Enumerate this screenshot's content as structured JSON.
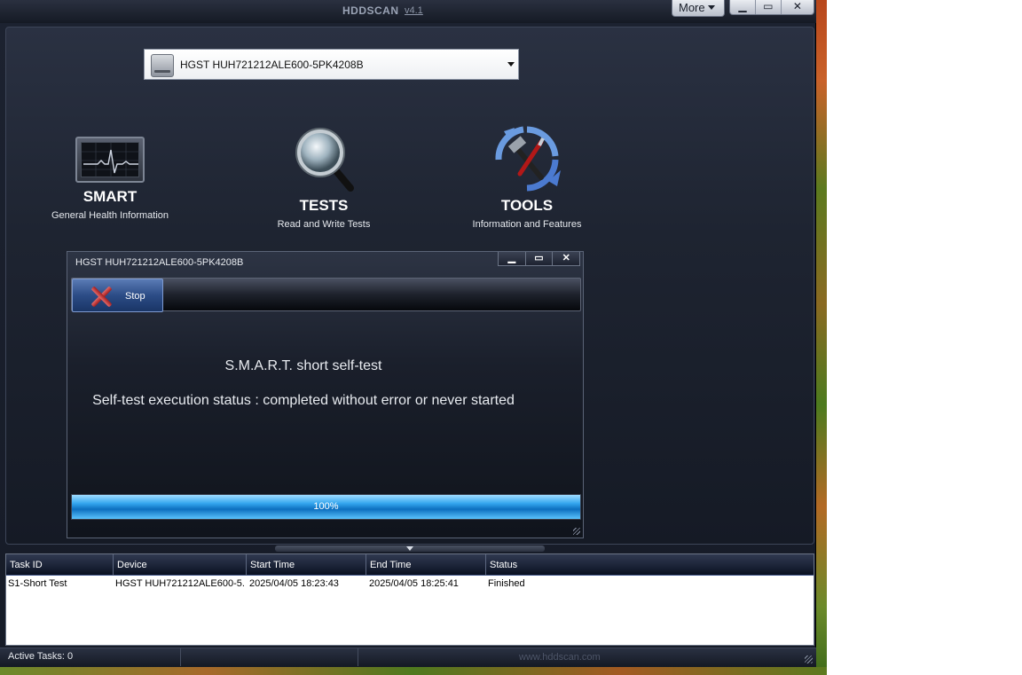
{
  "app": {
    "title": "HDDSCAN",
    "version": "v4.1",
    "more_label": "More",
    "win_minimize": "▁",
    "win_maximize": "▭",
    "win_close": "✕"
  },
  "drive": {
    "selected": "HGST HUH721212ALE600-5PK4208B"
  },
  "features": [
    {
      "title": "SMART",
      "subtitle": "General Health Information",
      "icon": "monitor-ecg-icon"
    },
    {
      "title": "TESTS",
      "subtitle": "Read and Write Tests",
      "icon": "magnifier-icon"
    },
    {
      "title": "TOOLS",
      "subtitle": "Information and Features",
      "icon": "tools-icon"
    }
  ],
  "dialog": {
    "title": "HGST HUH721212ALE600-5PK4208B",
    "stop_label": "Stop",
    "test_name": "S.M.A.R.T. short self-test",
    "status_message": "Self-test execution status : completed without error or never started",
    "progress_label": "100%",
    "progress_value": 100
  },
  "tasks": {
    "columns": [
      "Task ID",
      "Device",
      "Start Time",
      "End Time",
      "Status"
    ],
    "rows": [
      [
        "S1-Short Test",
        "HGST HUH721212ALE600-5...",
        "2025/04/05 18:23:43",
        "2025/04/05 18:25:41",
        "Finished"
      ]
    ]
  },
  "statusbar": {
    "active_tasks": "Active Tasks: 0",
    "url": "www.hddscan.com"
  },
  "colors": {
    "accent_blue": "#35a7ef",
    "stop_red": "#a21c1c"
  }
}
